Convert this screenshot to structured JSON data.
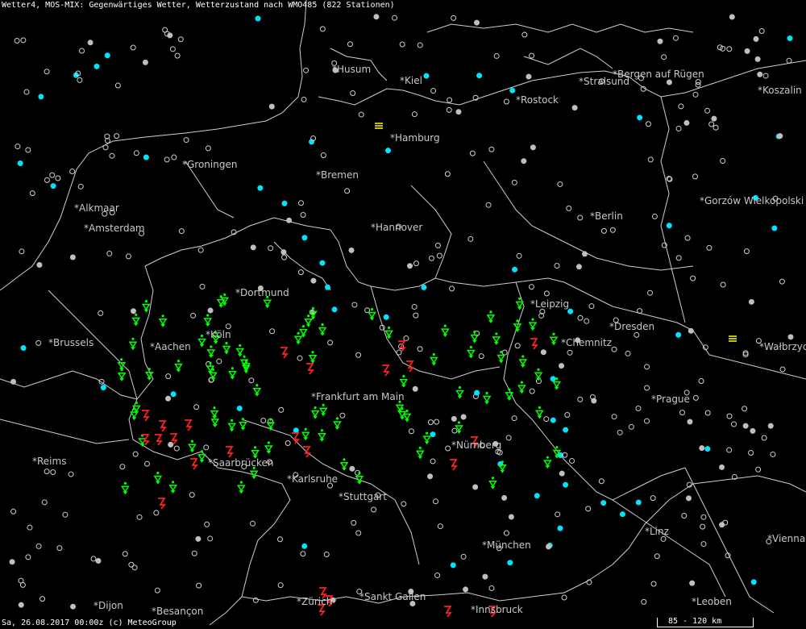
{
  "header": {
    "title": "Wetter4, MOS-MIX: Gegenwärtiges Wetter, Wetterzustand nach WMO485 (822 Stationen)"
  },
  "footer": {
    "timestamp": "Sa, 26.08.2017 00:00z (c) MeteoGroup"
  },
  "scale": {
    "label": "85 - 120 km"
  },
  "colors": {
    "background": "#000000",
    "border": "#cfcfcf",
    "label": "#c8c8c8",
    "rain": "#00ff00",
    "thunder": "#ff2020",
    "fog": "#ffff00",
    "partly_cloudy": "#00e5ff"
  },
  "cities": [
    {
      "name": "Husum"
    },
    {
      "name": "Kiel"
    },
    {
      "name": "Bergen auf Rügen"
    },
    {
      "name": "Stralsund"
    },
    {
      "name": "Rostock"
    },
    {
      "name": "Koszalin"
    },
    {
      "name": "Hamburg"
    },
    {
      "name": "Groningen"
    },
    {
      "name": "Bremen"
    },
    {
      "name": "Alkmaar"
    },
    {
      "name": "Amsterdam"
    },
    {
      "name": "Hannover"
    },
    {
      "name": "Berlin"
    },
    {
      "name": "Gorzów Wielkopolski"
    },
    {
      "name": "Dortmund"
    },
    {
      "name": "Leipzig"
    },
    {
      "name": "Dresden"
    },
    {
      "name": "Köln"
    },
    {
      "name": "Brussels"
    },
    {
      "name": "Aachen"
    },
    {
      "name": "Chemnitz"
    },
    {
      "name": "Wałbrzych"
    },
    {
      "name": "Frankfurt am Main"
    },
    {
      "name": "Prague"
    },
    {
      "name": "Nürnberg"
    },
    {
      "name": "Reims"
    },
    {
      "name": "Saarbrücken"
    },
    {
      "name": "Karlsruhe"
    },
    {
      "name": "Stuttgart"
    },
    {
      "name": "Linz"
    },
    {
      "name": "Vienna"
    },
    {
      "name": "München"
    },
    {
      "name": "Dijon"
    },
    {
      "name": "Zürich"
    },
    {
      "name": "Sankt Gallen"
    },
    {
      "name": "Leoben"
    },
    {
      "name": "Besançon"
    },
    {
      "name": "Innsbruck"
    }
  ]
}
